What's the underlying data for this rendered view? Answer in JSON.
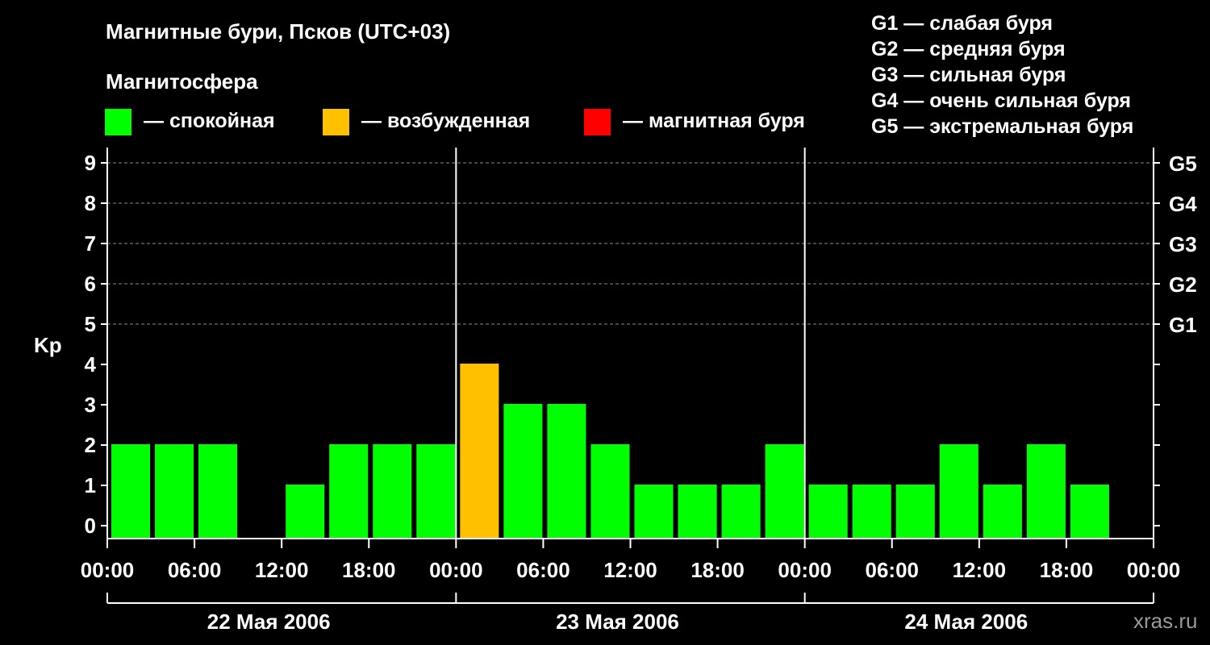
{
  "header": {
    "title": "Магнитные бури, Псков (UTC+03)",
    "subtitle": "Магнитосфера",
    "legend": [
      {
        "label": "— спокойная",
        "color": "#00ff00"
      },
      {
        "label": "— возбужденная",
        "color": "#ffc000"
      },
      {
        "label": "— магнитная буря",
        "color": "#ff0000"
      }
    ],
    "storm_levels": [
      "G1 — слабая буря",
      "G2 — средняя буря",
      "G3 — сильная буря",
      "G4 — очень сильная буря",
      "G5 — экстремальная буря"
    ]
  },
  "chart_data": {
    "type": "bar",
    "ylabel": "Kp",
    "ylim": [
      0,
      9
    ],
    "yticks": [
      "0",
      "1",
      "2",
      "3",
      "4",
      "5",
      "6",
      "7",
      "8",
      "9"
    ],
    "right_ticks": [
      {
        "label": "G1",
        "value": 5
      },
      {
        "label": "G2",
        "value": 6
      },
      {
        "label": "G3",
        "value": 7
      },
      {
        "label": "G4",
        "value": 8
      },
      {
        "label": "G5",
        "value": 9
      }
    ],
    "xticks": [
      "00:00",
      "06:00",
      "12:00",
      "18:00",
      "00:00",
      "06:00",
      "12:00",
      "18:00",
      "00:00",
      "06:00",
      "12:00",
      "18:00",
      "00:00"
    ],
    "days": [
      "22 Мая 2006",
      "23 Мая 2006",
      "24 Мая 2006"
    ],
    "interval_hours": 3,
    "values": [
      2,
      2,
      2,
      0,
      1,
      2,
      2,
      2,
      4,
      3,
      3,
      2,
      1,
      1,
      1,
      2,
      1,
      1,
      1,
      2,
      1,
      2,
      1,
      0
    ],
    "colors": {
      "quiet": "#00ff00",
      "active": "#ffc000",
      "storm": "#ff0000"
    },
    "grid": true
  },
  "watermark": "xras.ru"
}
